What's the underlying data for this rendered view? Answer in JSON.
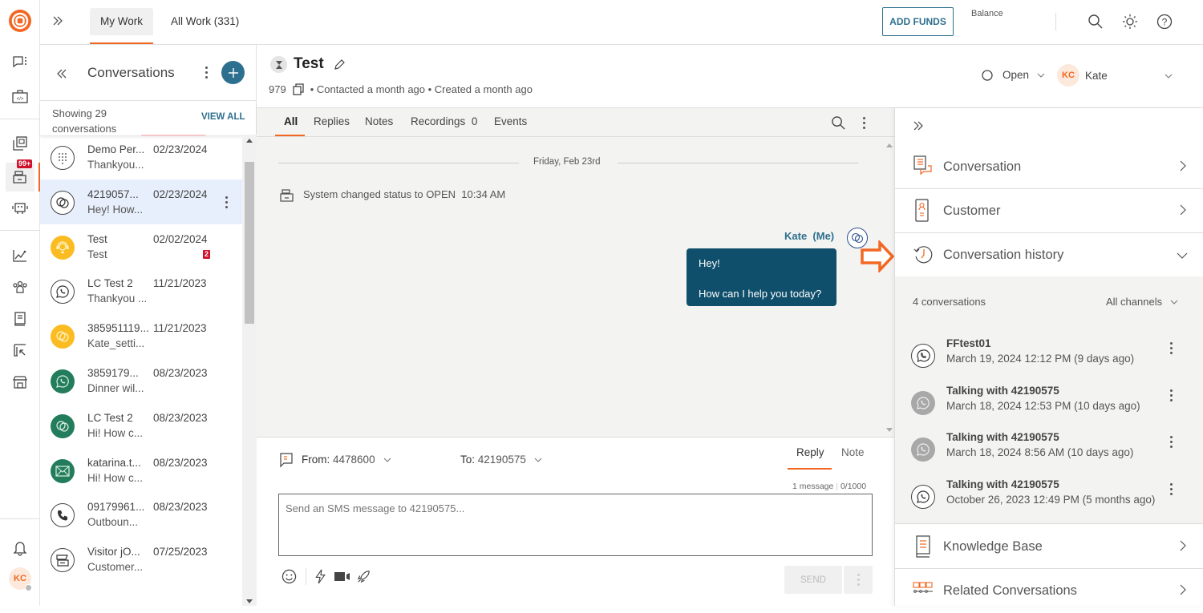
{
  "topbar": {
    "tabs": [
      {
        "label": "My Work",
        "active": true
      },
      {
        "label": "All Work (331)",
        "active": false
      }
    ],
    "add_funds_label": "ADD FUNDS",
    "balance_label": "Balance"
  },
  "rail": {
    "badge": "99+",
    "user_initials": "KC"
  },
  "conversations": {
    "title": "Conversations",
    "showing_line1": "Showing 29",
    "showing_line2": "conversations",
    "view_all": "VIEW ALL",
    "items": [
      {
        "name": "Demo Per...",
        "date": "02/23/2024",
        "preview": "Thankyou...",
        "channel": "dialpad-icon",
        "style": "outline"
      },
      {
        "name": "4219057...",
        "date": "02/23/2024",
        "preview": "Hey! How...",
        "channel": "chat-icon",
        "style": "outline",
        "selected": true
      },
      {
        "name": "Test",
        "date": "02/02/2024",
        "preview": "Test",
        "channel": "agent-icon",
        "style": "yellow",
        "unread": "2"
      },
      {
        "name": "LC Test 2",
        "date": "11/21/2023",
        "preview": "Thankyou ...",
        "channel": "whatsapp-icon",
        "style": "outline"
      },
      {
        "name": "385951119...",
        "date": "11/21/2023",
        "preview": "Kate_setti...",
        "channel": "chat-icon",
        "style": "yellow"
      },
      {
        "name": "3859179...",
        "date": "08/23/2023",
        "preview": "Dinner wil...",
        "channel": "whatsapp-icon",
        "style": "green"
      },
      {
        "name": "LC Test 2",
        "date": "08/23/2023",
        "preview": "Hi! How c...",
        "channel": "chat-icon",
        "style": "green"
      },
      {
        "name": "katarina.t...",
        "date": "08/23/2023",
        "preview": "Hi! How c...",
        "channel": "email-icon",
        "style": "green"
      },
      {
        "name": "09179961...",
        "date": "08/23/2023",
        "preview": "Outboun...",
        "channel": "phone-icon",
        "style": "outline"
      },
      {
        "name": "Visitor jO...",
        "date": "07/25/2023",
        "preview": "Customer...",
        "channel": "widget-icon",
        "style": "outline"
      }
    ]
  },
  "conversation": {
    "title": "Test",
    "id": "979",
    "meta": "• Contacted a month ago • Created a month ago",
    "status": "Open",
    "assignee_initials": "KC",
    "assignee": "Kate",
    "tabs": [
      {
        "label": "All",
        "active": true
      },
      {
        "label": "Replies"
      },
      {
        "label": "Notes"
      },
      {
        "label": "Recordings",
        "count": "0"
      },
      {
        "label": "Events"
      }
    ],
    "date_divider": "Friday, Feb 23rd",
    "system_event": "System changed status to OPEN",
    "system_event_time": "10:34 AM",
    "message": {
      "author": "Kate",
      "author_tag": "(Me)",
      "line1": "Hey!",
      "line2": "How can I help you today?"
    }
  },
  "composer": {
    "from_label": "From:",
    "from_value": "4478600",
    "to_label": "To:",
    "to_value": "42190575",
    "tabs": [
      {
        "label": "Reply",
        "active": true
      },
      {
        "label": "Note"
      }
    ],
    "message_count": "1 message",
    "char_count": "0/1000",
    "placeholder": "Send an SMS message to 42190575...",
    "send_label": "SEND"
  },
  "right_panel": {
    "sections": [
      {
        "label": "Conversation",
        "expanded": false
      },
      {
        "label": "Customer",
        "expanded": false
      },
      {
        "label": "Conversation history",
        "expanded": true
      },
      {
        "label": "Knowledge Base",
        "expanded": false
      },
      {
        "label": "Related Conversations",
        "expanded": false
      }
    ],
    "history": {
      "count_label": "4 conversations",
      "filter": "All channels",
      "items": [
        {
          "title": "FFtest01",
          "subtitle": "March 19, 2024 12:12 PM (9 days ago)",
          "channel": "viber-icon",
          "style": "outline"
        },
        {
          "title": "Talking with 42190575",
          "subtitle": "March 18, 2024 12:53 PM (10 days ago)",
          "channel": "whatsapp-icon",
          "style": "gray"
        },
        {
          "title": "Talking with 42190575",
          "subtitle": "March 18, 2024 8:56 AM (10 days ago)",
          "channel": "whatsapp-icon",
          "style": "gray"
        },
        {
          "title": "Talking with 42190575",
          "subtitle": "October 26, 2023 12:49 PM (5 months ago)",
          "channel": "whatsapp-icon",
          "style": "outline"
        }
      ]
    }
  },
  "colors": {
    "brand": "#f26722",
    "primary": "#2d6f8e",
    "bubble": "#0f4f6b",
    "whatsapp_green": "#237d5c",
    "yellow": "#fbbc21",
    "badge_red": "#d0112b"
  }
}
